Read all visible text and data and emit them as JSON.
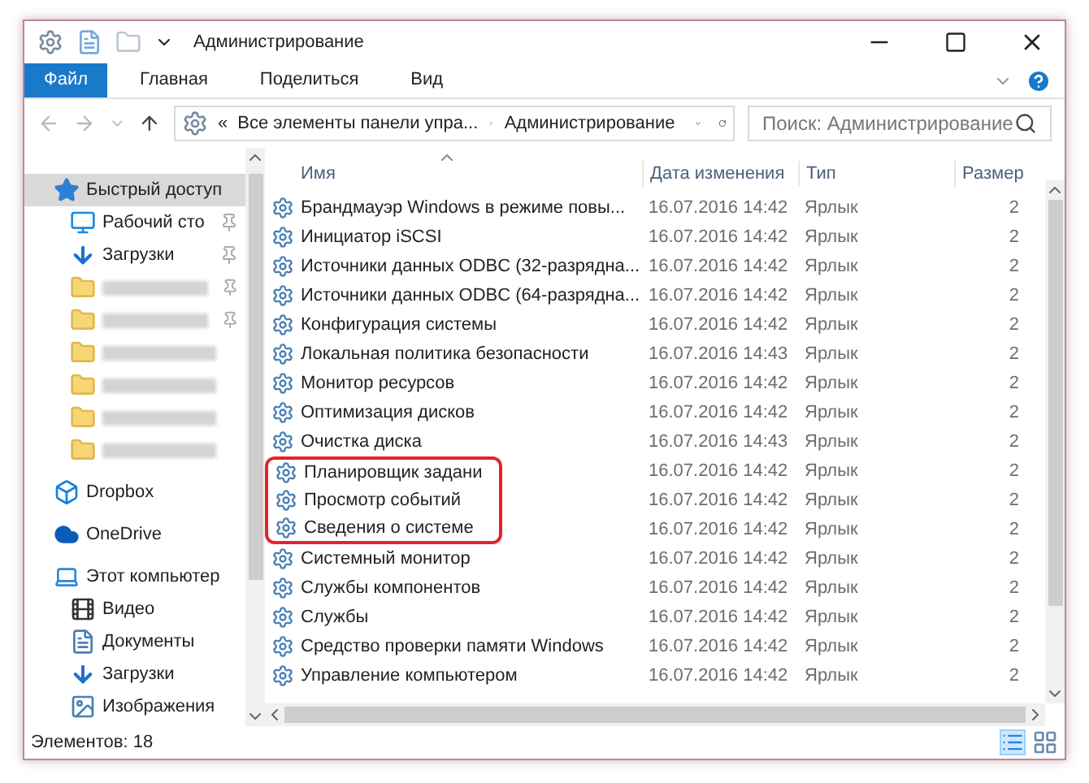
{
  "window": {
    "title": "Администрирование"
  },
  "ribbon_tabs": [
    {
      "label": "Файл",
      "selected": true
    },
    {
      "label": "Главная",
      "selected": false
    },
    {
      "label": "Поделиться",
      "selected": false
    },
    {
      "label": "Вид",
      "selected": false
    }
  ],
  "address": {
    "prefix": "«",
    "parts": [
      "Все элементы панели упра...",
      "Администрирование"
    ]
  },
  "search": {
    "placeholder": "Поиск: Администрирование"
  },
  "sidebar": {
    "items": [
      {
        "label": "Быстрый доступ",
        "kind": "star",
        "selected": true,
        "children": [
          {
            "label": "Рабочий сто",
            "kind": "desktop",
            "pinned": true
          },
          {
            "label": "Загрузки",
            "kind": "download",
            "pinned": true
          },
          {
            "kind": "folder-blurred",
            "pinned": true
          },
          {
            "kind": "folder-blurred",
            "pinned": true
          },
          {
            "kind": "folder-blurred",
            "pinned": false
          },
          {
            "kind": "folder-blurred",
            "pinned": false
          },
          {
            "kind": "folder-blurred",
            "pinned": false
          },
          {
            "kind": "folder-blurred",
            "pinned": false
          }
        ]
      },
      {
        "label": "Dropbox",
        "kind": "dropbox",
        "selected": false
      },
      {
        "label": "OneDrive",
        "kind": "cloud",
        "selected": false
      },
      {
        "label": "Этот компьютер",
        "kind": "computer",
        "selected": false,
        "children": [
          {
            "label": "Видео",
            "kind": "video"
          },
          {
            "label": "Документы",
            "kind": "document"
          },
          {
            "label": "Загрузки",
            "kind": "download"
          },
          {
            "label": "Изображения",
            "kind": "image"
          }
        ]
      }
    ]
  },
  "table": {
    "columns": [
      "Имя",
      "Дата изменения",
      "Тип",
      "Размер"
    ],
    "rows": [
      {
        "name": "Брандмауэр Windows в режиме повы...",
        "date": "16.07.2016 14:42",
        "type": "Ярлык",
        "size": "2",
        "highlighted": false
      },
      {
        "name": "Инициатор iSCSI",
        "date": "16.07.2016 14:42",
        "type": "Ярлык",
        "size": "2",
        "highlighted": false
      },
      {
        "name": "Источники данных ODBC (32-разрядна...",
        "date": "16.07.2016 14:42",
        "type": "Ярлык",
        "size": "2",
        "highlighted": false
      },
      {
        "name": "Источники данных ODBC (64-разрядна...",
        "date": "16.07.2016 14:42",
        "type": "Ярлык",
        "size": "2",
        "highlighted": false
      },
      {
        "name": "Конфигурация системы",
        "date": "16.07.2016 14:42",
        "type": "Ярлык",
        "size": "2",
        "highlighted": false
      },
      {
        "name": "Локальная политика безопасности",
        "date": "16.07.2016 14:43",
        "type": "Ярлык",
        "size": "2",
        "highlighted": false
      },
      {
        "name": "Монитор ресурсов",
        "date": "16.07.2016 14:42",
        "type": "Ярлык",
        "size": "2",
        "highlighted": false
      },
      {
        "name": "Оптимизация дисков",
        "date": "16.07.2016 14:42",
        "type": "Ярлык",
        "size": "2",
        "highlighted": false
      },
      {
        "name": "Очистка диска",
        "date": "16.07.2016 14:43",
        "type": "Ярлык",
        "size": "2",
        "highlighted": false
      },
      {
        "name": "Планировщик задани",
        "date": "16.07.2016 14:42",
        "type": "Ярлык",
        "size": "2",
        "highlighted": true
      },
      {
        "name": "Просмотр событий",
        "date": "16.07.2016 14:42",
        "type": "Ярлык",
        "size": "2",
        "highlighted": true
      },
      {
        "name": "Сведения о системе",
        "date": "16.07.2016 14:42",
        "type": "Ярлык",
        "size": "2",
        "highlighted": true
      },
      {
        "name": "Системный монитор",
        "date": "16.07.2016 14:42",
        "type": "Ярлык",
        "size": "2",
        "highlighted": false
      },
      {
        "name": "Службы компонентов",
        "date": "16.07.2016 14:42",
        "type": "Ярлык",
        "size": "2",
        "highlighted": false
      },
      {
        "name": "Службы",
        "date": "16.07.2016 14:42",
        "type": "Ярлык",
        "size": "2",
        "highlighted": false
      },
      {
        "name": "Средство проверки памяти Windows",
        "date": "16.07.2016 14:42",
        "type": "Ярлык",
        "size": "2",
        "highlighted": false
      },
      {
        "name": "Управление компьютером",
        "date": "16.07.2016 14:42",
        "type": "Ярлык",
        "size": "2",
        "highlighted": false
      }
    ]
  },
  "status_bar": {
    "count": "Элементов: 18"
  }
}
